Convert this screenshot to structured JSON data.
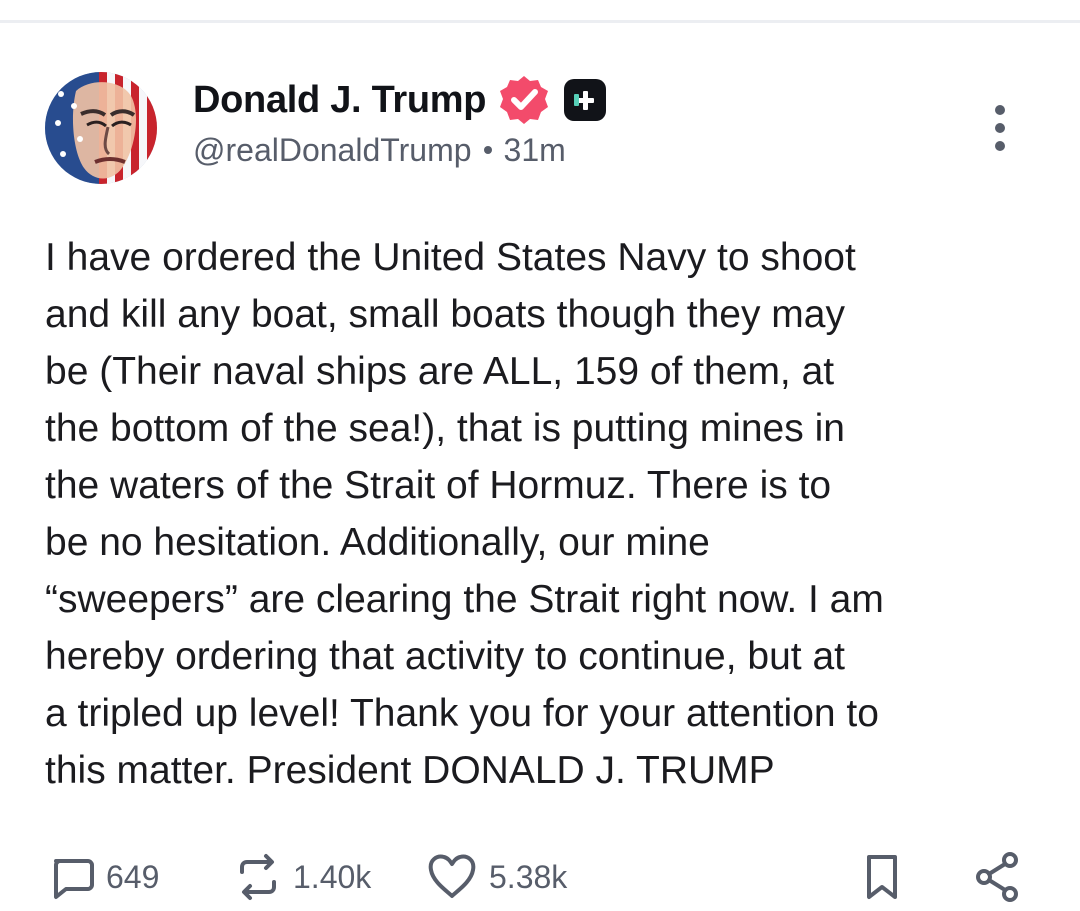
{
  "post": {
    "author": {
      "display_name": "Donald J. Trump",
      "handle": "@realDonaldTrump",
      "time_ago": "31m",
      "verified_icon": "verified-badge-icon",
      "plus_icon": "truth-plus-icon"
    },
    "body": "I have ordered the United States Navy to shoot\nand kill any boat, small boats though they may\nbe (Their naval ships are ALL, 159 of them, at\nthe bottom of the sea!), that is putting mines in\nthe waters of the Strait of Hormuz. There is to\nbe no hesitation. Additionally, our mine\n“sweepers” are clearing the Strait right now. I am\nhereby ordering that activity to continue, but at\na tripled up level! Thank you for your attention to\nthis matter. President DONALD J. TRUMP",
    "actions": {
      "replies": "649",
      "reposts": "1.40k",
      "likes": "5.38k"
    }
  },
  "icons": {
    "more": "more-vertical-icon",
    "reply": "reply-icon",
    "repost": "repost-icon",
    "like": "heart-icon",
    "bookmark": "bookmark-icon",
    "share": "share-icon"
  },
  "colors": {
    "verified": "#f34b6b",
    "plus_badge": "#111318",
    "secondary_text": "#575d6a"
  }
}
